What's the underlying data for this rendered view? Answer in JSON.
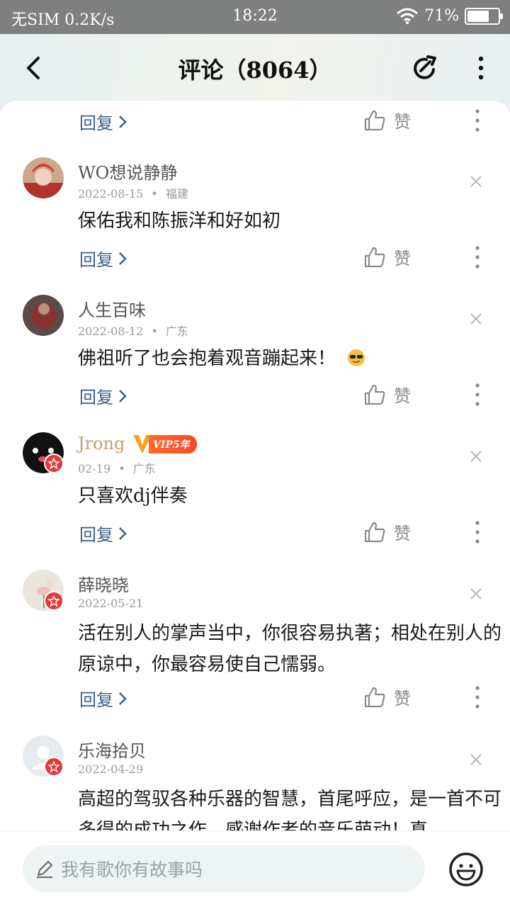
{
  "status_bar": {
    "left": "无SIM 0.2K/s",
    "time": "18:22",
    "battery": "71%",
    "battery_level": 0.71
  },
  "header": {
    "title": "评论（8064）"
  },
  "actions": {
    "reply_label": "回复",
    "like_label": "赞"
  },
  "comments": [
    {
      "name": "WO想说静静",
      "date": "2022-08-15",
      "location": "福建",
      "text": "保佑我和陈振洋和好如初"
    },
    {
      "name": "人生百味",
      "date": "2022-08-12",
      "location": "广东",
      "text": "佛祖听了也会抱着观音蹦起来！"
    },
    {
      "name": "Jrong",
      "vip_label": "VIP5年",
      "date": "02-19",
      "location": "广东",
      "text": "只喜欢dj伴奏"
    },
    {
      "name": "薛晓晓",
      "date": "2022-05-21",
      "text": "活在别人的掌声当中，你很容易执著；相处在别人的原谅中，你最容易使自己懦弱。"
    },
    {
      "name": "乐海拾贝",
      "date": "2022-04-29",
      "text": "高超的驾驭各种乐器的智慧，首尾呼应，是一首不可多得的成功之作。感谢作者的音乐萌动！真"
    }
  ],
  "separator": "•",
  "bottom": {
    "placeholder": "我有歌你有故事吗"
  },
  "colors": {
    "status_bar": "#7e7f7f",
    "reply_link": "#3a5f86",
    "vip_name": "#c4a070",
    "badge": "#e53838"
  }
}
